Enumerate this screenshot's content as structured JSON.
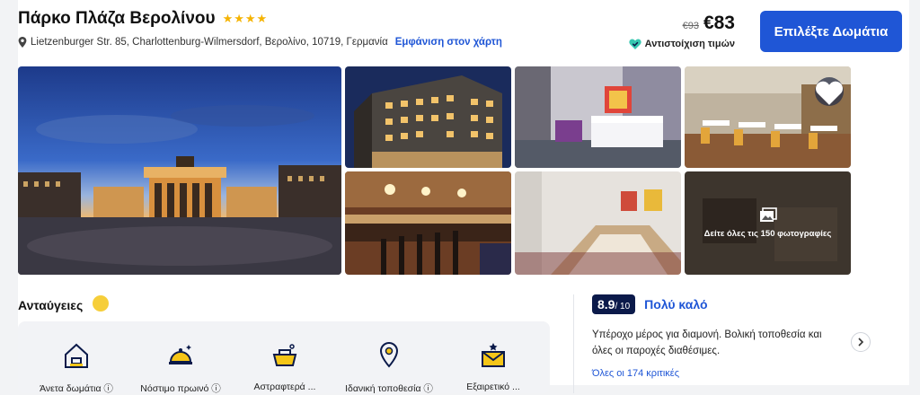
{
  "hotel": {
    "name": "Πάρκο Πλάζα Βερολίνου",
    "stars": "★★★★",
    "address": "Lietzenburger Str. 85, Charlottenburg-Wilmersdorf, Βερολίνο, 10719, Γερμανία",
    "map_link": "Εμφάνιση στον χάρτη"
  },
  "price": {
    "old": "€93",
    "new": "€83",
    "match_label": "Αντιστοίχιση τιμών"
  },
  "cta_label": "Επιλέξτε Δωμάτια",
  "gallery": {
    "see_all": "Δείτε όλες τις 150 φωτογραφίες"
  },
  "amenities": {
    "title": "Ανταύγειες",
    "items": [
      {
        "label": "Άνετα δωμάτια ⓘ",
        "icon": "house-icon"
      },
      {
        "label": "Νόστιμο πρωινό ⓘ",
        "icon": "cloche-icon"
      },
      {
        "label": "Αστραφτερά ...",
        "icon": "cleaning-basket-icon"
      },
      {
        "label": "Ιδανική τοποθεσία ⓘ",
        "icon": "location-pin-icon"
      },
      {
        "label": "Εξαιρετικό ...",
        "icon": "envelope-star-icon"
      }
    ]
  },
  "reviews": {
    "score": "8.9",
    "out_of": "/ 10",
    "verdict": "Πολύ καλό",
    "text": "Υπέροχο μέρος για διαμονή. Βολική τοποθεσία και όλες οι παροχές διαθέσιμες.",
    "link": "Όλες οι 174 κριτικές"
  },
  "colors": {
    "accent": "#1f56d6",
    "star": "#f5b301",
    "score_bg": "#0b1a4a"
  }
}
